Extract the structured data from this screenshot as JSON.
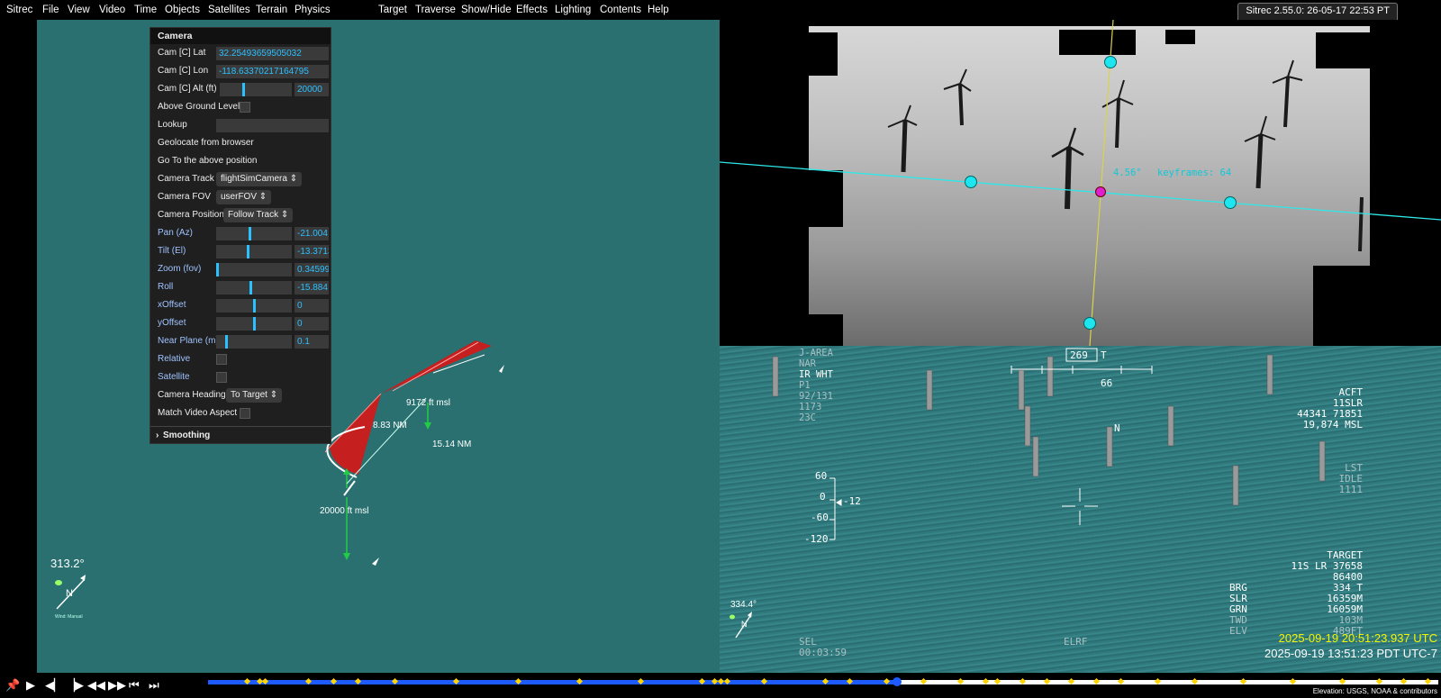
{
  "menus": [
    "Sitrec",
    "File",
    "View",
    "Video",
    "Time",
    "Objects",
    "Satellites",
    "Terrain",
    "Physics",
    "Target",
    "Traverse",
    "Show/Hide",
    "Effects",
    "Lighting",
    "Contents",
    "Help"
  ],
  "version": "Sitrec 2.55.0: 26-05-17 22:53 PT",
  "panel": {
    "title": "Camera",
    "cam_lat_label": "Cam [C] Lat",
    "cam_lat": "32.25493659505032",
    "cam_lon_label": "Cam [C] Lon",
    "cam_lon": "-118.63370217164795",
    "cam_alt_label": "Cam [C] Alt (ft)",
    "cam_alt": "20000",
    "agl_label": "Above Ground Level",
    "lookup_label": "Lookup",
    "geolocate_label": "Geolocate from browser",
    "goto_label": "Go To the above position",
    "track_label": "Camera Track",
    "track_value": "flightSimCamera",
    "fov_label": "Camera FOV",
    "fov_value": "userFOV",
    "position_label": "Camera Position",
    "position_value": "Follow Track",
    "pan_label": "Pan (Az)",
    "pan_value": "-21.004",
    "tilt_label": "Tilt (El)",
    "tilt_value": "-13.3713",
    "zoom_label": "Zoom (fov)",
    "zoom_value": "0.34599",
    "roll_label": "Roll",
    "roll_value": "-15.884",
    "xoffset_label": "xOffset",
    "xoffset_value": "0",
    "yoffset_label": "yOffset",
    "yoffset_value": "0",
    "near_label": "Near Plane (m)",
    "near_value": "0.1",
    "relative_label": "Relative",
    "satellite_label": "Satellite",
    "heading_label": "Camera Heading",
    "heading_value": "To Target",
    "match_label": "Match Video Aspect",
    "smoothing_label": "Smoothing"
  },
  "left_view": {
    "alt_label_1": "9172 ft msl",
    "dist_label_1": "8.83 NM",
    "dist_label_2": "15.14 NM",
    "alt_label_2": "20000 ft msl",
    "heading": "313.2°",
    "compass_n": "N",
    "wind_label": "Wind: Manual"
  },
  "video_overlay": {
    "angle": "4.56°",
    "keyframes": "keyframes: 64"
  },
  "hud": {
    "heading_box": "269",
    "heading_t": "T",
    "heading_sub": "66",
    "tl_lines": [
      "J-AREA",
      "NAR",
      "IR WHT",
      "P1",
      "92/131",
      "1173",
      "23C"
    ],
    "north": "N",
    "acft_lines": [
      "ACFT",
      "11SLR",
      "44341 71851",
      "19,874 MSL"
    ],
    "lst_lines": [
      "LST",
      "IDLE",
      "1111"
    ],
    "scale": [
      "60",
      "0",
      "-60",
      "-120"
    ],
    "scale_mark": "-12",
    "target_lines": [
      "TARGET",
      "11S LR 37658",
      "86400",
      "334 T",
      "16359M",
      "16059M",
      "103M",
      "489FT"
    ],
    "target_labels": [
      "BRG",
      "SLR",
      "GRN",
      "TWD",
      "ELV"
    ],
    "sel": "SEL",
    "sel_time": "00:03:59",
    "elrf": "ELRF",
    "compass_heading": "334.4°",
    "compass_n": "N",
    "utc": "2025-09-19 20:51:23.937 UTC",
    "pdt": "2025-09-19 13:51:23 PDT UTC-7"
  },
  "timeline": {
    "progress": 0.56,
    "credit": "Elevation: USGS, NOAA & contributors"
  },
  "colors": {
    "accent": "#2cc0ff",
    "ocean": "#2a7070",
    "track": "#1e5bff",
    "marker": "#ffd400"
  }
}
